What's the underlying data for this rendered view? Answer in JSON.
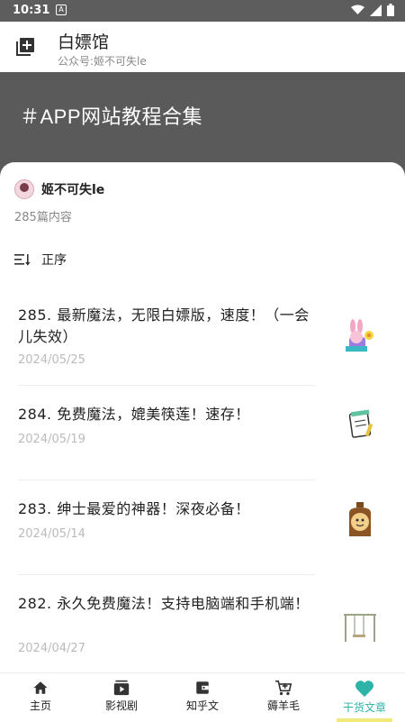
{
  "status": {
    "time": "10:31",
    "app_icon": "A"
  },
  "appbar": {
    "title": "白嫖馆",
    "subtitle": "公众号:姬不可失le"
  },
  "banner": {
    "title": "＃APP网站教程合集"
  },
  "author": {
    "name": "姬不可失le",
    "count": "285篇内容"
  },
  "sort": {
    "label": "正序"
  },
  "articles": [
    {
      "title": "285. 最新魔法，无限白嫖版，速度！（一会儿失效）",
      "date": "2024/05/25",
      "thumb_icon": "bunny-flower-icon"
    },
    {
      "title": "284. 免费魔法，媲美筷莲！速存！",
      "date": "2024/05/19",
      "thumb_icon": "notebook-icon"
    },
    {
      "title": "283. 绅士最爱的神器！深夜必备！",
      "date": "2024/05/14",
      "thumb_icon": "bottle-icon"
    },
    {
      "title": "282. 永久免费魔法！支持电脑端和手机端！",
      "date": "2024/04/27",
      "thumb_icon": "swing-icon"
    }
  ],
  "tabs": [
    {
      "label": "主页",
      "icon": "home-icon",
      "active": false
    },
    {
      "label": "影视剧",
      "icon": "video-icon",
      "active": false
    },
    {
      "label": "知乎文",
      "icon": "wallet-icon",
      "active": false
    },
    {
      "label": "薅羊毛",
      "icon": "cart-icon",
      "active": false
    },
    {
      "label": "干货文章",
      "icon": "heart-icon",
      "active": true
    }
  ],
  "colors": {
    "accent": "#2db3a8",
    "highlight": "#f1e97a",
    "banner": "#5a5a5a"
  }
}
